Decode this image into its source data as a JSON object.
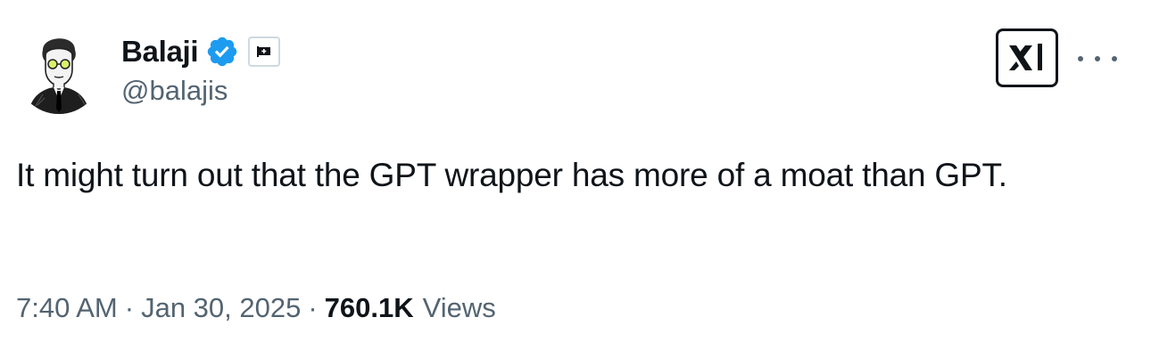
{
  "author": {
    "display_name": "Balaji",
    "handle": "@balajis",
    "verified_color": "#1d9bf0",
    "avatar_icon": "sketch-portrait-avatar",
    "affiliate_icon": "flag-badge-icon"
  },
  "affiliation_logo": "xai-logo",
  "tweet": {
    "text": "It might turn out that the GPT wrapper has more of a moat than GPT."
  },
  "meta": {
    "time": "7:40 AM",
    "separator": "·",
    "date": "Jan 30, 2025",
    "views_count": "760.1K",
    "views_label": "Views"
  }
}
